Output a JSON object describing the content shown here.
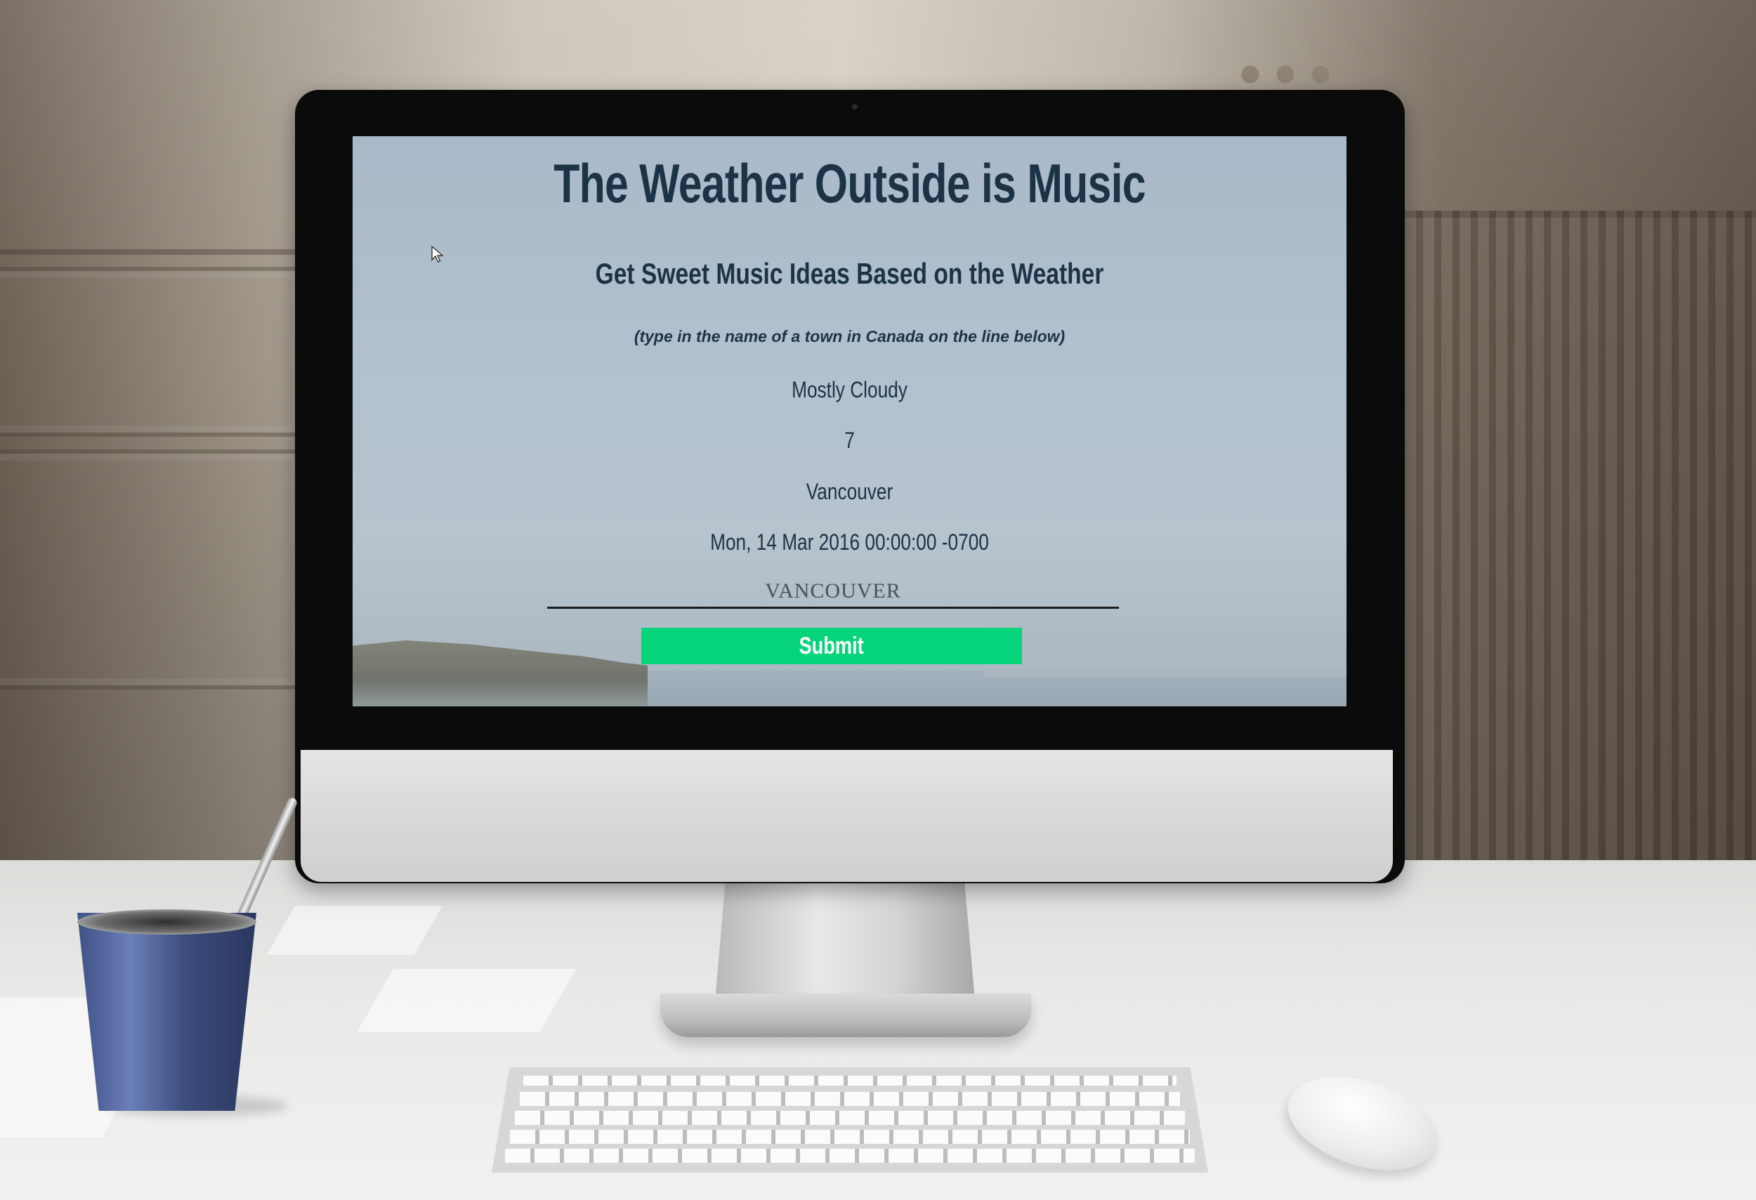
{
  "page": {
    "title": "The Weather Outside is Music",
    "subtitle": "Get Sweet Music Ideas Based on the Weather",
    "hint": "(type in the name of a town in Canada on the line below)"
  },
  "weather": {
    "condition": "Mostly Cloudy",
    "temperature": "7",
    "city": "Vancouver",
    "date": "Mon, 14 Mar 2016 00:00:00 -0700"
  },
  "form": {
    "city_input_value": "VANCOUVER",
    "submit_label": "Submit"
  },
  "colors": {
    "text": "#1c3347",
    "submit_button": "#05d47a",
    "screen_background": "#aab9c9"
  }
}
